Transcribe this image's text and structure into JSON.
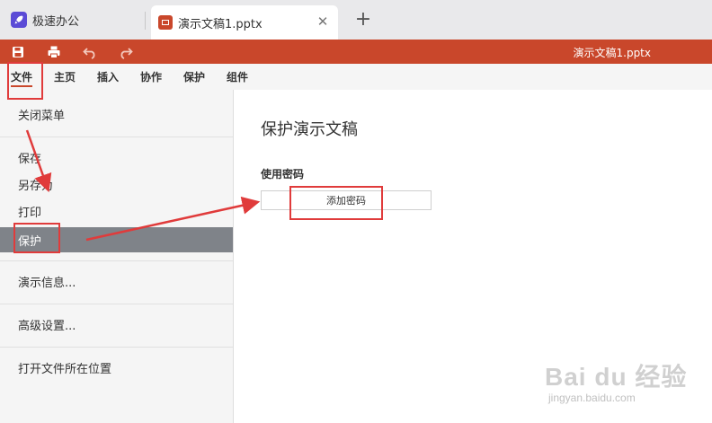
{
  "tabs": {
    "home_label": "极速办公",
    "doc_label": "演示文稿1.pptx",
    "close_glyph": "✕",
    "add_glyph": "+"
  },
  "titlebar": {
    "doc_title": "演示文稿1.pptx",
    "accent_color": "#c9472b"
  },
  "menu": {
    "items": [
      "文件",
      "主页",
      "插入",
      "协作",
      "保护",
      "组件"
    ],
    "active": "文件"
  },
  "sidebar": {
    "close_menu": "关闭菜单",
    "save": "保存",
    "save_as": "另存为",
    "print": "打印",
    "protect": "保护",
    "info": "演示信息...",
    "advanced": "高级设置...",
    "open_location": "打开文件所在位置"
  },
  "content": {
    "title": "保护演示文稿",
    "password_label": "使用密码",
    "add_password_button": "添加密码"
  },
  "watermark": {
    "main": "Bai du 经验",
    "sub": "jingyan.baidu.com"
  },
  "icons": {
    "app": "rocket-icon",
    "doc": "presentation-icon",
    "save": "save-icon",
    "print": "print-icon",
    "undo": "undo-icon",
    "redo": "redo-icon"
  },
  "annotation_color": "#e03b3b"
}
